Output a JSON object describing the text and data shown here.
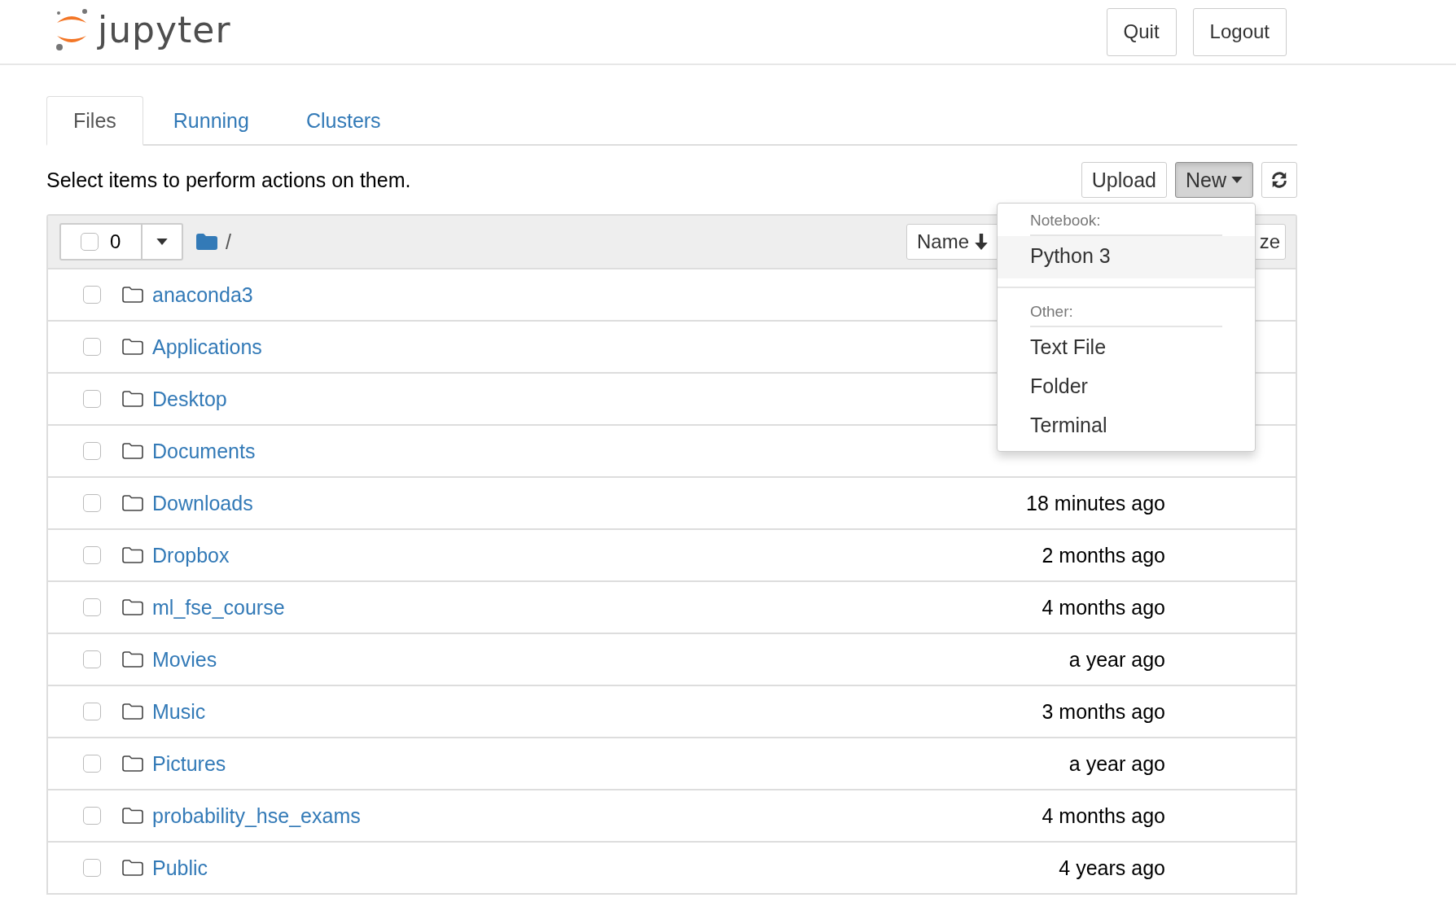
{
  "header": {
    "logo_text": "jupyter",
    "buttons": [
      "Quit",
      "Logout"
    ]
  },
  "tabs": [
    {
      "label": "Files",
      "selected": true
    },
    {
      "label": "Running",
      "selected": false
    },
    {
      "label": "Clusters",
      "selected": false
    }
  ],
  "toolbar": {
    "hint": "Select items to perform actions on them.",
    "buttons": [
      {
        "kind": "text",
        "label": "Upload",
        "active": false
      },
      {
        "kind": "dropdown",
        "label": "New",
        "active": true
      },
      {
        "kind": "refresh",
        "active": false
      }
    ]
  },
  "list_header": {
    "checked": false,
    "selected_count": "0",
    "path": "/",
    "columns": [
      {
        "kind": "sort",
        "label": "Name"
      },
      {
        "kind": "plain",
        "label": "ze"
      }
    ]
  },
  "rows": [
    {
      "name": "anaconda3",
      "checked": false
    },
    {
      "name": "Applications",
      "checked": false
    },
    {
      "name": "Desktop",
      "checked": false
    },
    {
      "name": "Documents",
      "checked": false
    },
    {
      "name": "Downloads",
      "checked": false,
      "modified": "18 minutes ago"
    },
    {
      "name": "Dropbox",
      "checked": false,
      "modified": "2 months ago"
    },
    {
      "name": "ml_fse_course",
      "checked": false,
      "modified": "4 months ago"
    },
    {
      "name": "Movies",
      "checked": false,
      "modified": "a year ago"
    },
    {
      "name": "Music",
      "checked": false,
      "modified": "3 months ago"
    },
    {
      "name": "Pictures",
      "checked": false,
      "modified": "a year ago"
    },
    {
      "name": "probability_hse_exams",
      "checked": false,
      "modified": "4 months ago"
    },
    {
      "name": "Public",
      "checked": false,
      "modified": "4 years ago"
    }
  ],
  "menu": {
    "sections": [
      {
        "heading": "Notebook:",
        "items": [
          {
            "label": "Python 3",
            "selected": true
          }
        ]
      },
      {
        "heading": "Other:",
        "items": [
          {
            "label": "Text File",
            "selected": false
          },
          {
            "label": "Folder",
            "selected": false
          },
          {
            "label": "Terminal",
            "selected": false
          }
        ]
      }
    ]
  }
}
